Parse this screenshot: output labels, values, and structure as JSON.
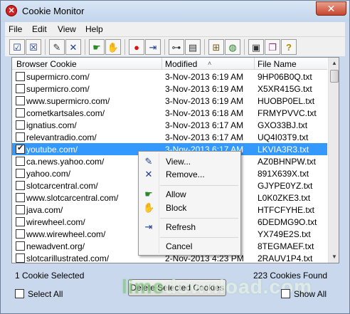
{
  "window": {
    "title": "Cookie Monitor",
    "close_glyph": "✕"
  },
  "menu": [
    "File",
    "Edit",
    "View",
    "Help"
  ],
  "toolbar": [
    {
      "icon": "select-all-icon",
      "glyph": "☑"
    },
    {
      "icon": "deselect-icon",
      "glyph": "☒"
    },
    {
      "icon": "edit-icon",
      "glyph": "✎"
    },
    {
      "icon": "remove-icon",
      "glyph": "✕"
    },
    {
      "icon": "allow-icon",
      "glyph": "☛"
    },
    {
      "icon": "block-icon",
      "glyph": "✋"
    },
    {
      "icon": "record-icon",
      "glyph": "●"
    },
    {
      "icon": "refresh-icon",
      "glyph": "⇥"
    },
    {
      "icon": "pin-icon",
      "glyph": "⊶"
    },
    {
      "icon": "log-icon",
      "glyph": "▤"
    },
    {
      "icon": "tree-icon",
      "glyph": "⊞"
    },
    {
      "icon": "globe-icon",
      "glyph": "◍"
    },
    {
      "icon": "properties-icon",
      "glyph": "▣"
    },
    {
      "icon": "book-icon",
      "glyph": "❐"
    },
    {
      "icon": "help-icon",
      "glyph": "?"
    }
  ],
  "columns": {
    "name": "Browser Cookie",
    "modified": "Modified",
    "file": "File Name",
    "sort_indicator": "˄"
  },
  "rows": [
    {
      "name": "supermicro.com/",
      "modified": "3-Nov-2013 6:19 AM",
      "file": "9HP06B0Q.txt",
      "checked": false,
      "selected": false
    },
    {
      "name": "supermicro.com/",
      "modified": "3-Nov-2013 6:19 AM",
      "file": "X5XR415G.txt",
      "checked": false,
      "selected": false
    },
    {
      "name": "www.supermicro.com/",
      "modified": "3-Nov-2013 6:19 AM",
      "file": "HUOBP0EL.txt",
      "checked": false,
      "selected": false
    },
    {
      "name": "cometkartsales.com/",
      "modified": "3-Nov-2013 6:18 AM",
      "file": "FRMYPVVC.txt",
      "checked": false,
      "selected": false
    },
    {
      "name": "ignatius.com/",
      "modified": "3-Nov-2013 6:17 AM",
      "file": "GXO33BJ.txt",
      "checked": false,
      "selected": false
    },
    {
      "name": "relevantradio.com/",
      "modified": "3-Nov-2013 6:17 AM",
      "file": "UQ4I03T9.txt",
      "checked": false,
      "selected": false
    },
    {
      "name": "youtube.com/",
      "modified": "3-Nov-2013 6:17 AM",
      "file": "LKVIA3R3.txt",
      "checked": true,
      "selected": true
    },
    {
      "name": "ca.news.yahoo.com/",
      "modified": "",
      "file": "AZ0BHNPW.txt",
      "checked": false,
      "selected": false
    },
    {
      "name": "yahoo.com/",
      "modified": "",
      "file": "891X639X.txt",
      "checked": false,
      "selected": false
    },
    {
      "name": "slotcarcentral.com/",
      "modified": "",
      "file": "GJYPE0YZ.txt",
      "checked": false,
      "selected": false
    },
    {
      "name": "www.slotcarcentral.com/",
      "modified": "",
      "file": "L0K0ZKE3.txt",
      "checked": false,
      "selected": false
    },
    {
      "name": "java.com/",
      "modified": "",
      "file": "HTFCFYHE.txt",
      "checked": false,
      "selected": false
    },
    {
      "name": "wirewheel.com/",
      "modified": "",
      "file": "6DEDMG9O.txt",
      "checked": false,
      "selected": false
    },
    {
      "name": "www.wirewheel.com/",
      "modified": "",
      "file": "YX749E2S.txt",
      "checked": false,
      "selected": false
    },
    {
      "name": "newadvent.org/",
      "modified": "",
      "file": "8TEGMAEF.txt",
      "checked": false,
      "selected": false
    },
    {
      "name": "slotcarillustrated.com/",
      "modified": "2-Nov-2013 4:23 PM",
      "file": "2RAUV1P4.txt",
      "checked": false,
      "selected": false
    }
  ],
  "context_menu": [
    {
      "label": "View...",
      "icon": "view-icon",
      "glyph": "✎",
      "color": "#1a3a8a"
    },
    {
      "label": "Remove...",
      "icon": "remove-icon",
      "glyph": "✕",
      "color": "#1a3a8a"
    },
    {
      "label": "Allow",
      "icon": "allow-icon",
      "glyph": "☛",
      "color": "#2a8a2a"
    },
    {
      "label": "Block",
      "icon": "block-icon",
      "glyph": "✋",
      "color": "#b02020"
    },
    {
      "label": "Refresh",
      "icon": "refresh-icon",
      "glyph": "⇥",
      "color": "#1a3a8a"
    },
    {
      "label": "Cancel",
      "icon": "",
      "glyph": "",
      "color": "#000"
    }
  ],
  "status": {
    "selected_count": "1 Cookie Selected",
    "found_count": "223 Cookies Found",
    "select_all": "Select All",
    "delete_button": "Delete Selected Cookies",
    "show_all": "Show All"
  },
  "watermark": {
    "part1": "lime",
    "part2": "download.com"
  }
}
